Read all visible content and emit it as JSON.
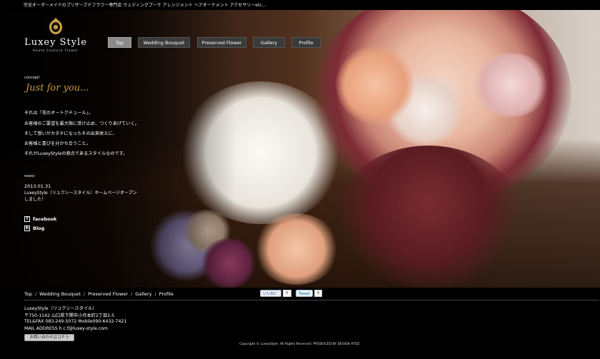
{
  "tagline": "完全オーダーメイドのプリザーブドフラワー専門店 ウェディングブーケ アレンジメント ヘアオーナメント アクセサリーetc...",
  "logo": {
    "name": "Luxey Style",
    "sub": "Haute Couture Flower"
  },
  "nav": [
    {
      "label": "Top",
      "active": true
    },
    {
      "label": "Wedding Bouquet",
      "active": false
    },
    {
      "label": "Preserved Flower",
      "active": false
    },
    {
      "label": "Gallery",
      "active": false
    },
    {
      "label": "Profile",
      "active": false
    }
  ],
  "concept": {
    "label": "concept/",
    "heading": "Just for you...",
    "lines": [
      "それは「花のオートクチュール」。",
      "お客様のご要望を最大限に受け止め、つくりあげていく。",
      "そして想いがカタチになったその出来栄えに、",
      "お客様と喜びを分かち合うこと。",
      "それがLuxeyStyleの原点であるスタイルなのです。"
    ]
  },
  "news": {
    "label": "news/",
    "date": "2013.01.31",
    "text": "LuxeyStyle（リュクシースタイル）ホームページオープンしました！"
  },
  "social": {
    "facebook": "facebook",
    "blog": "Blog",
    "facebook_icon": "f",
    "blog_icon": "b"
  },
  "footer_nav": [
    "Top",
    "Wedding Bouquet",
    "Preserved Flower",
    "Gallery",
    "Profile"
  ],
  "footer_sep": "/",
  "share": {
    "like_label": "いいね！",
    "like_count": "0",
    "tweet_label": "Tweet",
    "tweet_count": "0"
  },
  "company": {
    "name": "LuxeyStyle（リュクシースタイル）",
    "address": "〒750-1142 山口県下関市小月本町2丁目2-5",
    "tel": "TEL&FAX 083-249-5072 Mobile090-6432-7421",
    "mail": "MAIL ADDRESS h.c.f@luxey-style.com",
    "contact_button": "お問い合わせはコチラ"
  },
  "copyright": "Copyright © LuxeyStyle. All Rights Reserved. PRODUCED BY DESIGN ATOZ."
}
